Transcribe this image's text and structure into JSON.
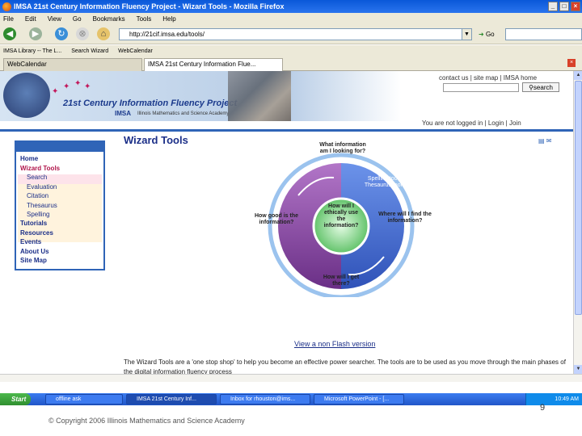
{
  "window": {
    "title": "IMSA 21st Century Information Fluency Project - Wizard Tools - Mozilla Firefox"
  },
  "menu": [
    "File",
    "Edit",
    "View",
    "Go",
    "Bookmarks",
    "Tools",
    "Help"
  ],
  "navbar": {
    "url": "http://21cif.imsa.edu/tools/",
    "go_label": "Go"
  },
  "bookmarks": [
    "IMSA Library -- The L...",
    "Search Wizard",
    "WebCalendar"
  ],
  "tabs": [
    "WebCalendar",
    "IMSA 21st Century Information Flue..."
  ],
  "banner": {
    "title": "21st Century Information Fluency Project",
    "imsa": "IMSA",
    "imsa_sub": "Illinois Mathematics and Science Academy",
    "top_links": "contact us | site map | IMSA home",
    "search_label": "search",
    "login_status": "You are not logged in",
    "login_link": "Login",
    "join_link": "Join"
  },
  "sidenav": [
    "Home",
    "Wizard Tools",
    "Search",
    "Evaluation",
    "Citation",
    "Thesaurus",
    "Spelling",
    "Tutorials",
    "Resources",
    "Events",
    "About Us",
    "Site Map"
  ],
  "main": {
    "heading": "Wizard Tools",
    "diagram": {
      "top": "What information am I looking for?",
      "tools": "Spelling tool Thesaurus tool",
      "right": "Where will I find the information?",
      "left": "How good is the information?",
      "center": "How will I ethically use the information?",
      "bottom": "How will I get there?"
    },
    "nonflash_link": "View a non Flash version",
    "paragraph": "The Wizard Tools are a 'one stop shop' to help you become an effective power searcher. The tools are to be used as you move through the main phases of the digital information fluency process"
  },
  "taskbar": {
    "start": "Start",
    "tasks": [
      "offline ask",
      "IMSA 21st Century Inf...",
      "Inbox for rhouston@ims...",
      "Microsoft PowerPoint - [..."
    ],
    "time": "10:49 AM"
  },
  "slide": {
    "copyright": "© Copyright 2006 Illinois Mathematics and Science Academy",
    "page_number": "9"
  }
}
